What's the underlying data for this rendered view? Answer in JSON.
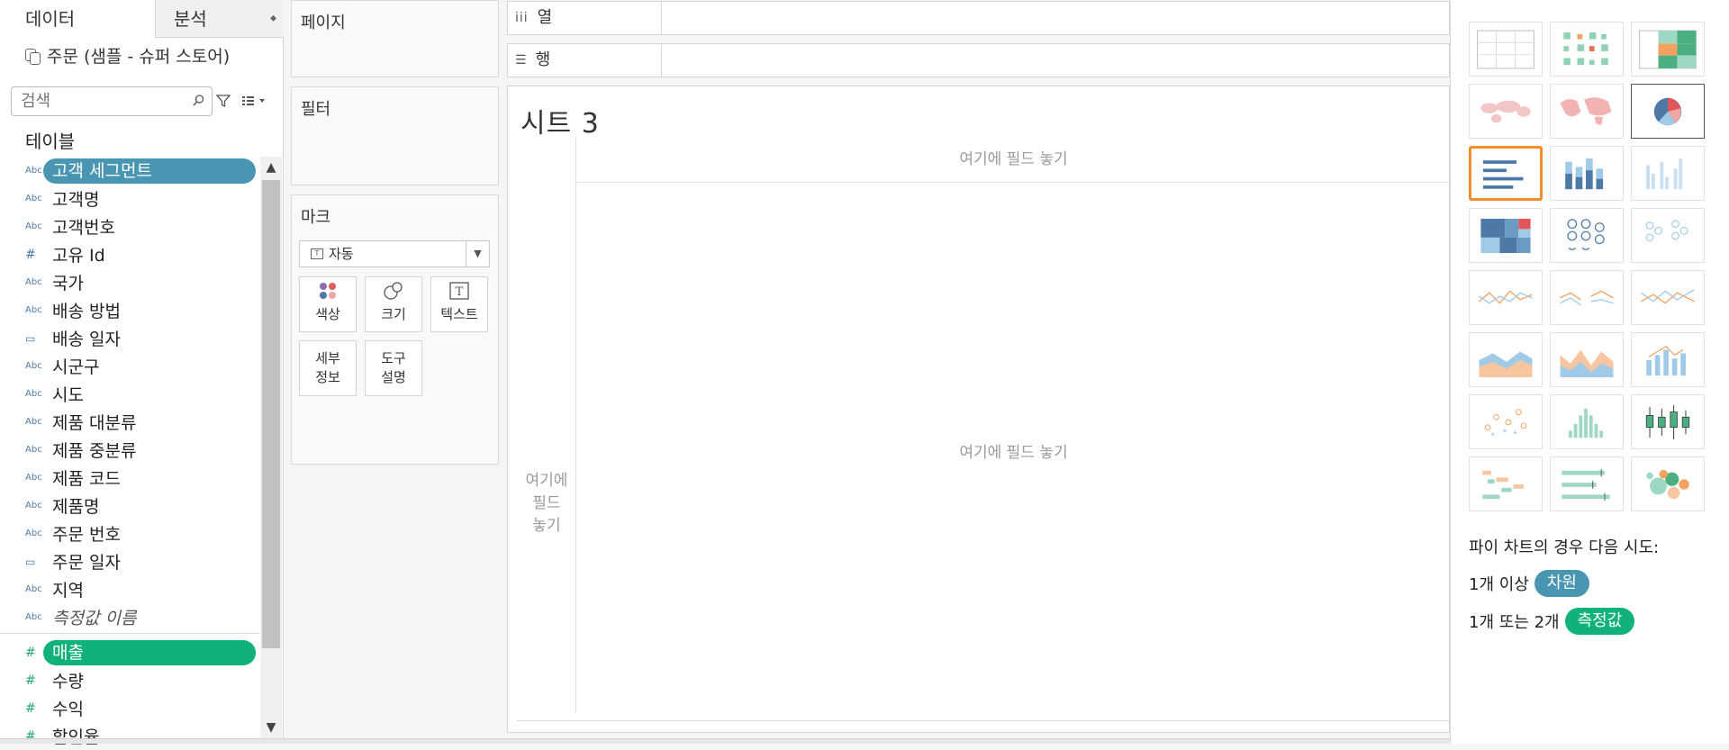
{
  "data_pane": {
    "tabs": [
      {
        "label": "데이터",
        "active": true
      },
      {
        "label": "분석",
        "active": false
      }
    ],
    "datasource": "주문 (샘플 - 슈퍼 스토어)",
    "search_placeholder": "검색",
    "tables_title": "테이블",
    "dimensions": [
      {
        "icon": "Abc",
        "label": "고객 세그먼트",
        "selected": true
      },
      {
        "icon": "Abc",
        "label": "고객명"
      },
      {
        "icon": "Abc",
        "label": "고객번호"
      },
      {
        "icon": "#",
        "label": "고유 Id"
      },
      {
        "icon": "Abc",
        "label": "국가"
      },
      {
        "icon": "Abc",
        "label": "배송 방법"
      },
      {
        "icon": "date",
        "label": "배송 일자"
      },
      {
        "icon": "Abc",
        "label": "시군구"
      },
      {
        "icon": "Abc",
        "label": "시도"
      },
      {
        "icon": "Abc",
        "label": "제품 대분류"
      },
      {
        "icon": "Abc",
        "label": "제품 중분류"
      },
      {
        "icon": "Abc",
        "label": "제품 코드"
      },
      {
        "icon": "Abc",
        "label": "제품명"
      },
      {
        "icon": "Abc",
        "label": "주문 번호"
      },
      {
        "icon": "date",
        "label": "주문 일자"
      },
      {
        "icon": "Abc",
        "label": "지역"
      },
      {
        "icon": "Abc",
        "label": "측정값 이름",
        "italic": true
      }
    ],
    "measures": [
      {
        "icon": "#",
        "label": "매출",
        "selected": true
      },
      {
        "icon": "#",
        "label": "수량"
      },
      {
        "icon": "#",
        "label": "수익"
      },
      {
        "icon": "#",
        "label": "할인율"
      }
    ]
  },
  "cards": {
    "pages": "페이지",
    "filters": "필터",
    "marks": {
      "title": "마크",
      "type": "자동",
      "buttons": [
        {
          "label": "색상",
          "icon": "color-icon"
        },
        {
          "label": "크기",
          "icon": "size-icon"
        },
        {
          "label": "텍스트",
          "icon": "text-icon"
        }
      ],
      "buttons2": [
        {
          "line1": "세부",
          "line2": "정보"
        },
        {
          "line1": "도구",
          "line2": "설명"
        }
      ]
    }
  },
  "shelves": {
    "columns": "열",
    "rows": "행"
  },
  "canvas": {
    "sheet_title": "시트 3",
    "drop_top": "여기에 필드 놓기",
    "drop_left_1": "여기에",
    "drop_left_2": "필드",
    "drop_left_3": "놓기",
    "drop_center": "여기에 필드 놓기"
  },
  "showme": {
    "selected_index": 6,
    "hovered_index": 5,
    "hint_title": "파이 차트의 경우 다음 시도:",
    "hint_row1_prefix": "1개 이상",
    "hint_row1_pill": "차원",
    "hint_row2_prefix": "1개 또는 2개",
    "hint_row2_pill": "측정값"
  },
  "colors": {
    "dimension": "#4996b2",
    "measure": "#10b279",
    "selected_outline": "#f28e2b"
  }
}
